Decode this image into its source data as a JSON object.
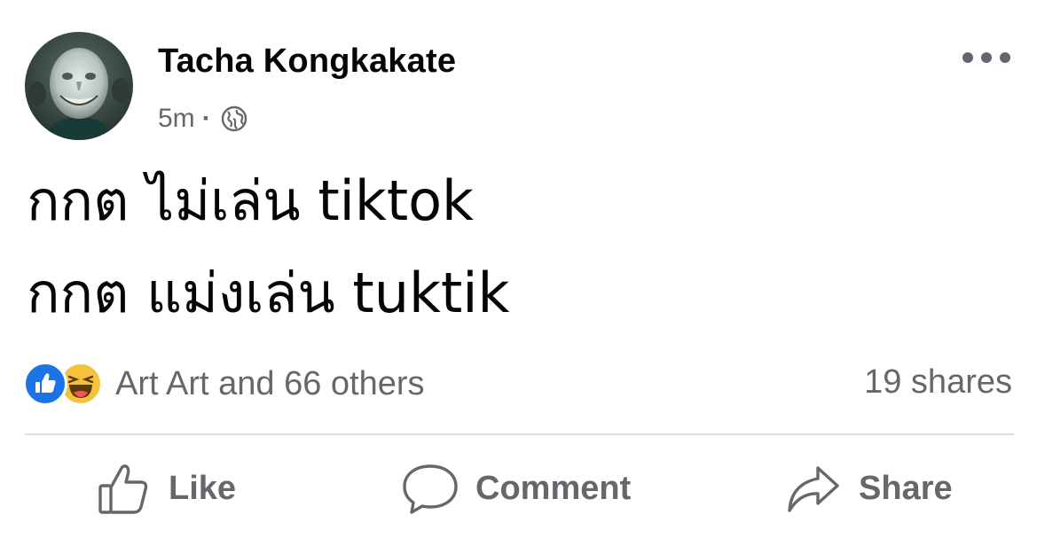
{
  "post": {
    "author": "Tacha Kongkakate",
    "timestamp": "5m",
    "separator": "·",
    "privacy_icon": "globe-icon",
    "more_icon": "more-options-icon",
    "text_lines": [
      "กกต ไม่เล่น tiktok",
      "กกต แม่งเล่น tuktik"
    ]
  },
  "reactions": {
    "icons": [
      "like-reaction-icon",
      "haha-reaction-icon"
    ],
    "summary": "Art Art and 66 others",
    "shares": "19 shares"
  },
  "actions": {
    "like_label": "Like",
    "comment_label": "Comment",
    "share_label": "Share"
  },
  "colors": {
    "text_primary": "#050505",
    "text_secondary": "#65676b",
    "like_blue": "#1b74e4",
    "haha_yellow": "#f7c23b",
    "divider": "#dadde1"
  }
}
